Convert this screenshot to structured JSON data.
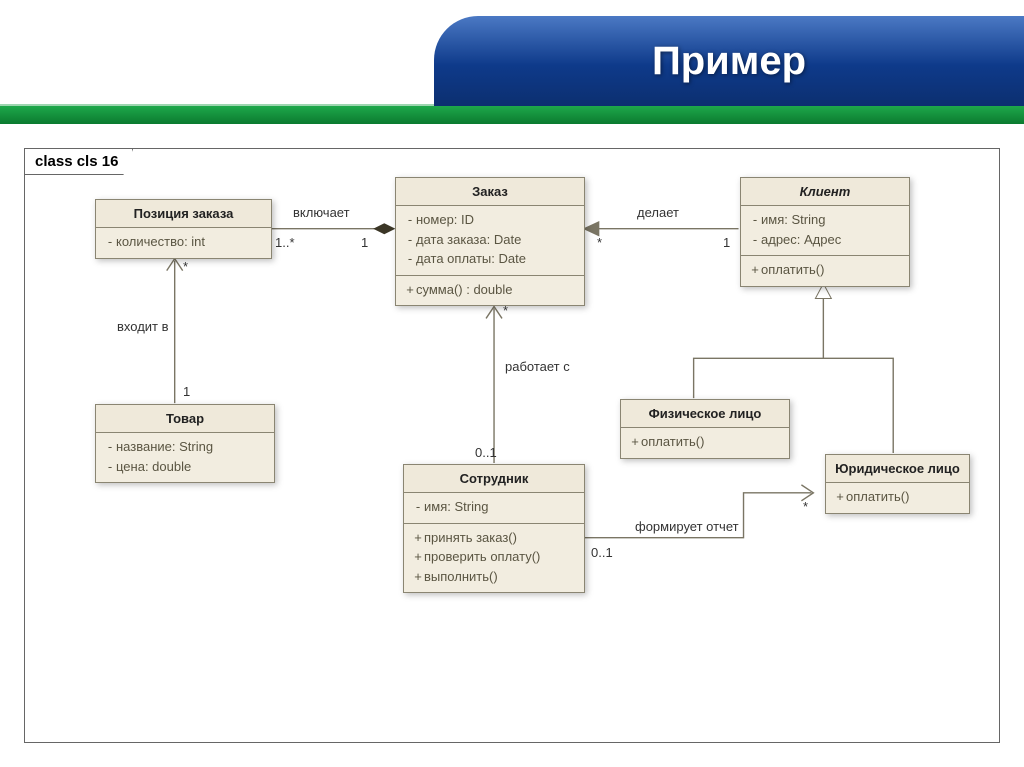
{
  "header": {
    "title": "Пример"
  },
  "frame": {
    "label": "class cls 16"
  },
  "classes": {
    "orderItem": {
      "name": "Позиция заказа",
      "attrs": [
        "количество: int"
      ]
    },
    "product": {
      "name": "Товар",
      "attrs": [
        "название: String",
        "цена: double"
      ]
    },
    "order": {
      "name": "Заказ",
      "attrs": [
        "номер: ID",
        "дата заказа: Date",
        "дата оплаты: Date"
      ],
      "ops": [
        "сумма() : double"
      ]
    },
    "employee": {
      "name": "Сотрудник",
      "attrs": [
        "имя: String"
      ],
      "ops": [
        "принять заказ()",
        "проверить оплату()",
        "выполнить()"
      ]
    },
    "client": {
      "name": "Клиент",
      "attrs": [
        "имя: String",
        "адрес: Адрес"
      ],
      "ops": [
        "оплатить()"
      ]
    },
    "person": {
      "name": "Физическое лицо",
      "ops": [
        "оплатить()"
      ]
    },
    "company": {
      "name": "Юридическое лицо",
      "ops": [
        "оплатить()"
      ]
    }
  },
  "labels": {
    "includes": "включает",
    "enters": "входит в",
    "worksWith": "работает с",
    "makes": "делает",
    "report": "формирует отчет"
  },
  "mult": {
    "includes_left": "1..*",
    "includes_right": "1",
    "enters_top": "*",
    "enters_bottom": "1",
    "works_top": "*",
    "works_bottom": "0..1",
    "makes_left": "*",
    "makes_right": "1",
    "report_left": "0..1",
    "report_right": "*"
  }
}
